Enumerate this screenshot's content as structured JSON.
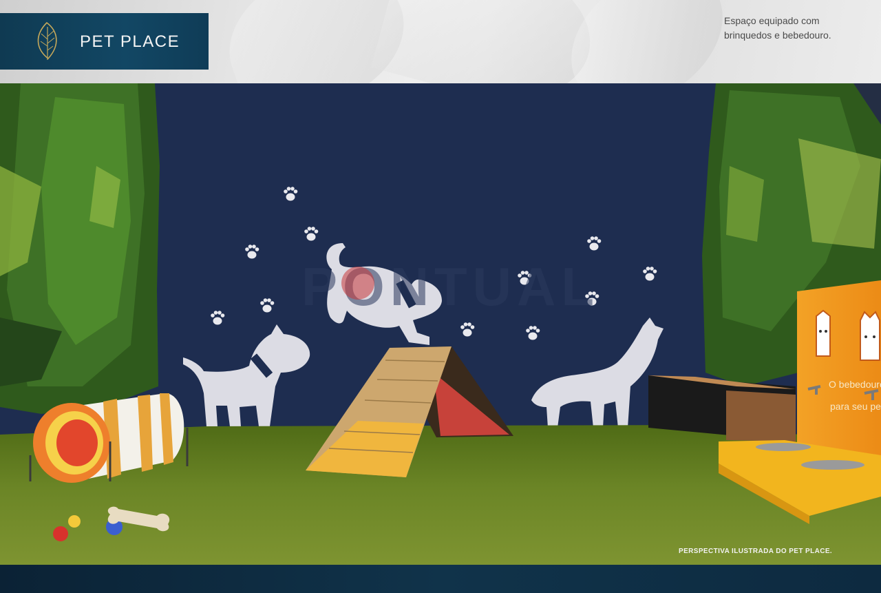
{
  "header": {
    "title": "PET PLACE",
    "description_line1": "Espaço equipado com",
    "description_line2": "brinquedos e bebedouro."
  },
  "scene": {
    "sign_line1": "O bebedouro",
    "sign_line2": "para seu pet",
    "watermark": "PONTUAL",
    "caption": "PERSPECTIVA ILUSTRADA DO PET PLACE."
  },
  "colors": {
    "brand_navy": "#124764",
    "wall": "#1f2f52",
    "grass": "#5f7a1f",
    "sign_orange": "#f29a1c",
    "ivy": "#3d6b22"
  },
  "icons": [
    "leaf-logo-icon",
    "paw-print-icon",
    "dog-silhouette-icon",
    "cat-face-icon",
    "dog-face-icon",
    "faucet-icon"
  ]
}
